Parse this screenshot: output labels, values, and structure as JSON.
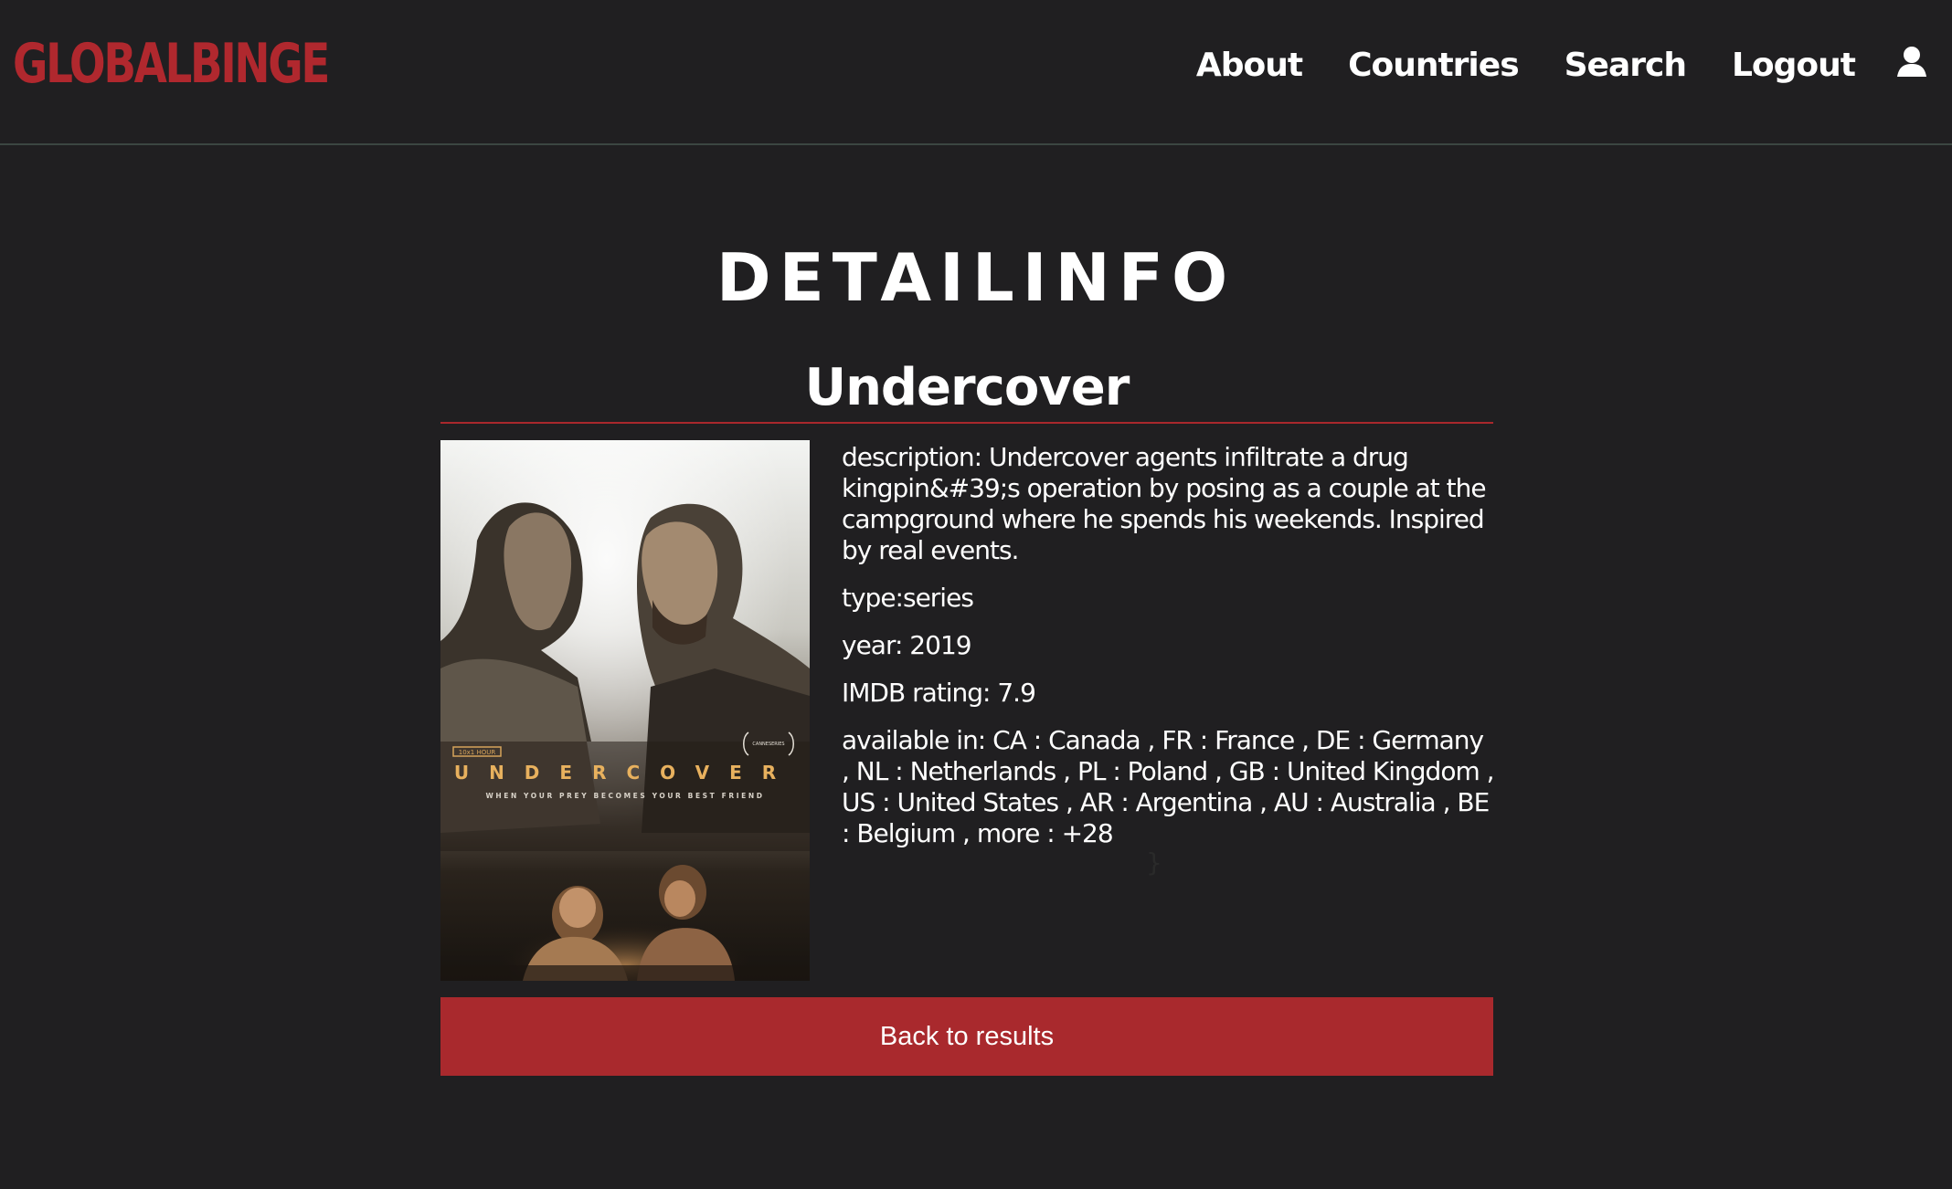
{
  "brand": {
    "logo_text": "GLOBALBINGE",
    "accent_color": "#b0282e"
  },
  "nav": {
    "items": [
      {
        "label": "About"
      },
      {
        "label": "Countries"
      },
      {
        "label": "Search"
      },
      {
        "label": "Logout"
      }
    ],
    "user_icon": "user-icon"
  },
  "page": {
    "title": "DETAILINFO"
  },
  "title": {
    "name": "Undercover",
    "description": "description: Undercover agents infiltrate a drug kingpin&#39;s operation by posing as a couple at the campground where he spends his weekends. Inspired by real events.",
    "type": "type:series",
    "year": "year: 2019",
    "imdb": "IMDB rating: 7.9",
    "available": "available in: CA : Canada , FR : France , DE : Germany , NL : Netherlands , PL : Poland , GB : United Kingdom , US : United States , AR : Argentina , AU : Australia , BE : Belgium , more : +28",
    "stray_char": "}",
    "poster": {
      "title_text": "UNDERCOVER",
      "tagline": "WHEN YOUR PREY BECOMES YOUR BEST FRIEND",
      "badge": "10x1 HOUR",
      "laurel": "CANNESERIES"
    }
  },
  "actions": {
    "back_label": "Back to results"
  }
}
